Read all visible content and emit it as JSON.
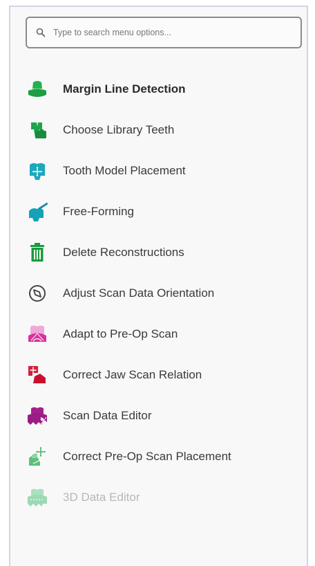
{
  "search": {
    "placeholder": "Type to search menu options..."
  },
  "menu": {
    "items": [
      {
        "label": "Margin Line Detection",
        "icon": "margin-line-icon",
        "color": "#1fa84a"
      },
      {
        "label": "Choose Library Teeth",
        "icon": "library-teeth-icon",
        "color": "#1a9a4a"
      },
      {
        "label": "Tooth Model Placement",
        "icon": "tooth-placement-icon",
        "color": "#18a8b8"
      },
      {
        "label": "Free-Forming",
        "icon": "free-forming-icon",
        "color": "#14a0b4"
      },
      {
        "label": "Delete Reconstructions",
        "icon": "trash-icon",
        "color": "#1e9a3e"
      },
      {
        "label": "Adjust Scan Data Orientation",
        "icon": "compass-icon",
        "color": "#444444"
      },
      {
        "label": "Adapt to Pre-Op Scan",
        "icon": "pre-op-adapt-icon",
        "color": "#d83aa8"
      },
      {
        "label": "Correct Jaw Scan Relation",
        "icon": "jaw-relation-icon",
        "color": "#d41e3c"
      },
      {
        "label": "Scan Data Editor",
        "icon": "scan-editor-icon",
        "color": "#a01e8c"
      },
      {
        "label": "Correct Pre-Op Scan Placement",
        "icon": "pre-op-placement-icon",
        "color": "#5cc07a"
      },
      {
        "label": "3D Data Editor",
        "icon": "3d-editor-icon",
        "color": "#7ad09a"
      }
    ]
  }
}
